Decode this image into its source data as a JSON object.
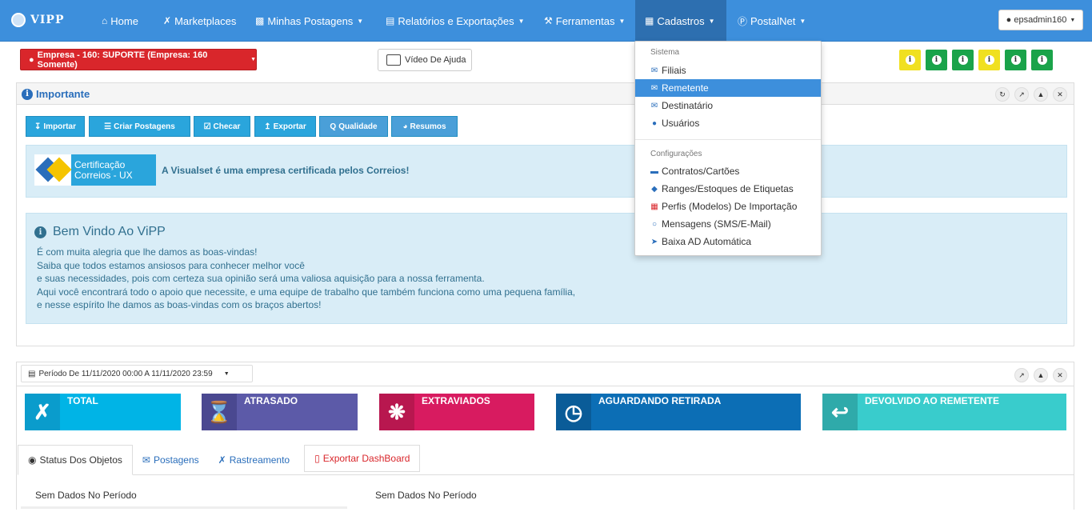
{
  "app": {
    "brand": "VIPP"
  },
  "nav": {
    "home": "Home",
    "marketplaces": "Marketplaces",
    "minhas_postagens": "Minhas Postagens",
    "relatorios": "Relatórios e Exportações",
    "ferramentas": "Ferramentas",
    "cadastros": "Cadastros",
    "postalnet": "PostalNet",
    "user": "epsadmin160"
  },
  "empresa_button": "Empresa - 160: SUPORTE (Empresa: 160 Somente)",
  "help_button": "Vídeo De Ajuda",
  "info_buttons": [
    {
      "color": "#f0e020"
    },
    {
      "color": "#1aa34a"
    },
    {
      "color": "#1aa34a"
    },
    {
      "color": "#f0e020"
    },
    {
      "color": "#1aa34a"
    },
    {
      "color": "#1aa34a"
    }
  ],
  "important_panel": {
    "title": "Importante",
    "actions": [
      "Importar",
      "Criar Postagens",
      "Checar",
      "Exportar",
      "Qualidade",
      "Resumos"
    ],
    "cert_logo_line1": "Certificação",
    "cert_logo_line2": "Correios - UX",
    "cert_message": "A Visualset é uma empresa certificada pelos Correios!",
    "welcome_title": "Bem Vindo Ao ViPP",
    "welcome_lines": [
      "É com muita alegria que lhe damos as boas-vindas!",
      "Saiba que todos estamos ansiosos para conhecer melhor você",
      "e suas necessidades, pois com certeza sua opinião será uma valiosa aquisição para a nossa ferramenta.",
      "Aqui você encontrará todo o apoio que necessite, e uma equipe de trabalho que também funciona como uma pequena família,",
      "e nesse espírito lhe damos as boas-vindas com os braços abertos!"
    ]
  },
  "dashboard": {
    "period": "Período De 11/11/2020 00:00 A 11/11/2020 23:59",
    "stats": [
      {
        "label": "TOTAL",
        "color": "#00b4e6",
        "icon": "marketplaces-icon"
      },
      {
        "label": "ATRASADO",
        "color": "#5c5aa8",
        "icon": "hourglass-icon"
      },
      {
        "label": "EXTRAVIADOS",
        "color": "#d81b60",
        "icon": "bug-icon"
      },
      {
        "label": "AGUARDANDO RETIRADA",
        "color": "#0c6eb5",
        "icon": "clock-icon"
      },
      {
        "label": "DEVOLVIDO AO REMETENTE",
        "color": "#39cccc",
        "icon": "return-icon"
      }
    ],
    "tabs": [
      "Status Dos Objetos",
      "Postagens",
      "Rastreamento",
      "Exportar DashBoard"
    ],
    "no_data_left": "Sem Dados No Período",
    "no_data_right": "Sem Dados No Período"
  },
  "cadastros_menu": {
    "section1": "Sistema",
    "section1_items": [
      "Filiais",
      "Remetente",
      "Destinatário",
      "Usuários"
    ],
    "section2": "Configurações",
    "section2_items": [
      "Contratos/Cartões",
      "Ranges/Estoques de Etiquetas",
      "Perfis (Modelos) De Importação",
      "Mensagens (SMS/E-Mail)",
      "Baixa AD Automática"
    ]
  }
}
